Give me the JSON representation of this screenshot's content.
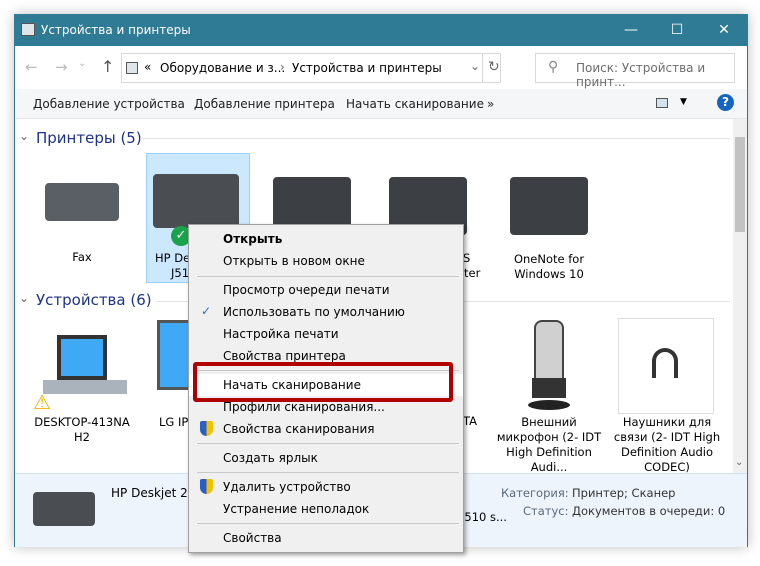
{
  "window": {
    "title": "Устройства и принтеры",
    "minimize": "—",
    "maximize": "☐",
    "close": "✕"
  },
  "nav": {
    "back": "←",
    "forward": "→",
    "recent": "⌄",
    "up": "↑"
  },
  "address": {
    "overflow": "«",
    "crumbs": [
      "Оборудование и з...",
      "Устройства и принтеры"
    ],
    "sep": "›",
    "dropdown": "⌄",
    "refresh": "↻"
  },
  "search": {
    "placeholder": "Поиск: Устройства и принт..."
  },
  "toolbar": {
    "add_device": "Добавление устройства",
    "add_printer": "Добавление принтера",
    "start_scan": "Начать сканирование",
    "more": "»",
    "help": "?"
  },
  "groups": {
    "printers": "Принтеры (5)",
    "devices": "Устройства (6)"
  },
  "printers": [
    {
      "label": "Fax",
      "icon": "fax-icon"
    },
    {
      "label_line1": "HP De",
      "label_line2": "J510",
      "icon": "printer-icon",
      "selected": true,
      "default": true
    },
    {
      "label_line1": "S",
      "label_line2": "ter",
      "icon": "printer-icon"
    },
    {
      "label": "OneNote for Windows 10",
      "icon": "printer-icon"
    }
  ],
  "devices": [
    {
      "label": "DESKTOP-413NA H2",
      "icon": "laptop-icon",
      "warning": true
    },
    {
      "label": "LG IPS",
      "icon": "monitor-icon"
    },
    {
      "label": "TA",
      "icon": "device-icon"
    },
    {
      "label": "Внешний микрофон (2- IDT High Definition Audi...",
      "icon": "microphone-icon"
    },
    {
      "label": "Наушники для связи (2- IDT High Definition Audio CODEC)",
      "icon": "headphones-icon"
    }
  ],
  "details": {
    "name": "HP Deskjet 20",
    "model": "J510 s...",
    "category_label": "Категория:",
    "category": "Принтер; Сканер",
    "status_label": "Статус:",
    "status": "Документов в очереди: 0"
  },
  "context_menu": {
    "open": "Открыть",
    "open_new": "Открыть в новом окне",
    "queue": "Просмотр очереди печати",
    "default": "Использовать по умолчанию",
    "print_prefs": "Настройка печати",
    "printer_props": "Свойства принтера",
    "start_scan": "Начать сканирование",
    "scan_profiles": "Профили сканирования...",
    "scan_props": "Свойства сканирования",
    "shortcut": "Создать ярлык",
    "remove": "Удалить устройство",
    "troubleshoot": "Устранение неполадок",
    "properties": "Свойства",
    "checkmark": "✓"
  },
  "colors": {
    "titlebar": "#2f7b96",
    "highlight": "#b00000",
    "selection": "#cce8ff",
    "group": "#1e3287"
  }
}
